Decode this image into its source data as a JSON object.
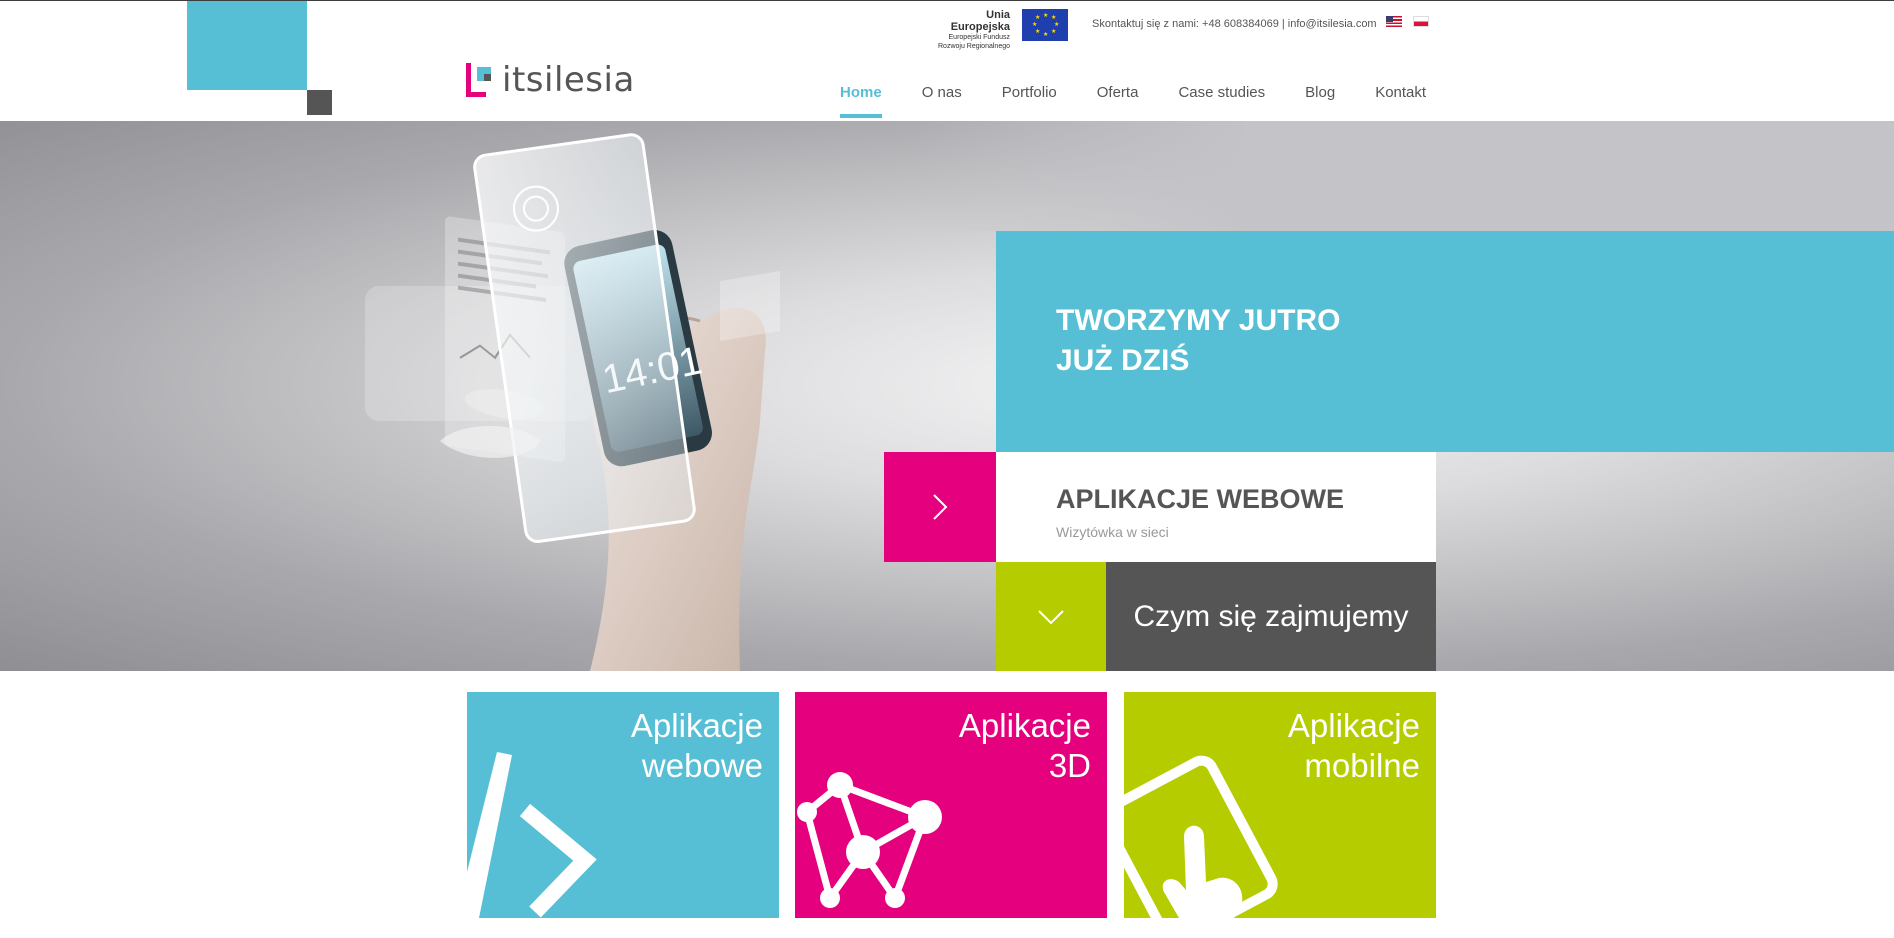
{
  "header": {
    "logo_text": "itsilesia",
    "eu": {
      "title": "Unia Europejska",
      "sub1": "Europejski Fundusz",
      "sub2": "Rozwoju Regionalnego"
    },
    "contact": "Skontaktuj się z nami: +48 608384069 | info@itsilesia.com",
    "languages": [
      "en-flag-icon",
      "pl-flag-icon"
    ]
  },
  "nav": {
    "items": [
      {
        "label": "Home",
        "active": true
      },
      {
        "label": "O nas"
      },
      {
        "label": "Portfolio"
      },
      {
        "label": "Oferta"
      },
      {
        "label": "Case studies"
      },
      {
        "label": "Blog"
      },
      {
        "label": "Kontakt"
      }
    ]
  },
  "hero": {
    "title_line1": "TWORZYMY JUTRO",
    "title_line2": "JUŻ DZIŚ",
    "slide_title": "APLIKACJE WEBOWE",
    "slide_subtitle": "Wizytówka w sieci",
    "cta": "Czym się zajmujemy",
    "phone_time": "14:01"
  },
  "tiles": [
    {
      "line1": "Aplikacje",
      "line2": "webowe",
      "icon": "code-bracket-icon"
    },
    {
      "line1": "Aplikacje",
      "line2": "3D",
      "icon": "molecule-3d-icon"
    },
    {
      "line1": "Aplikacje",
      "line2": "mobilne",
      "icon": "touch-tablet-icon"
    }
  ],
  "colors": {
    "teal": "#57bfd5",
    "magenta": "#e5007d",
    "lime": "#b4cc00",
    "dark": "#555555"
  }
}
